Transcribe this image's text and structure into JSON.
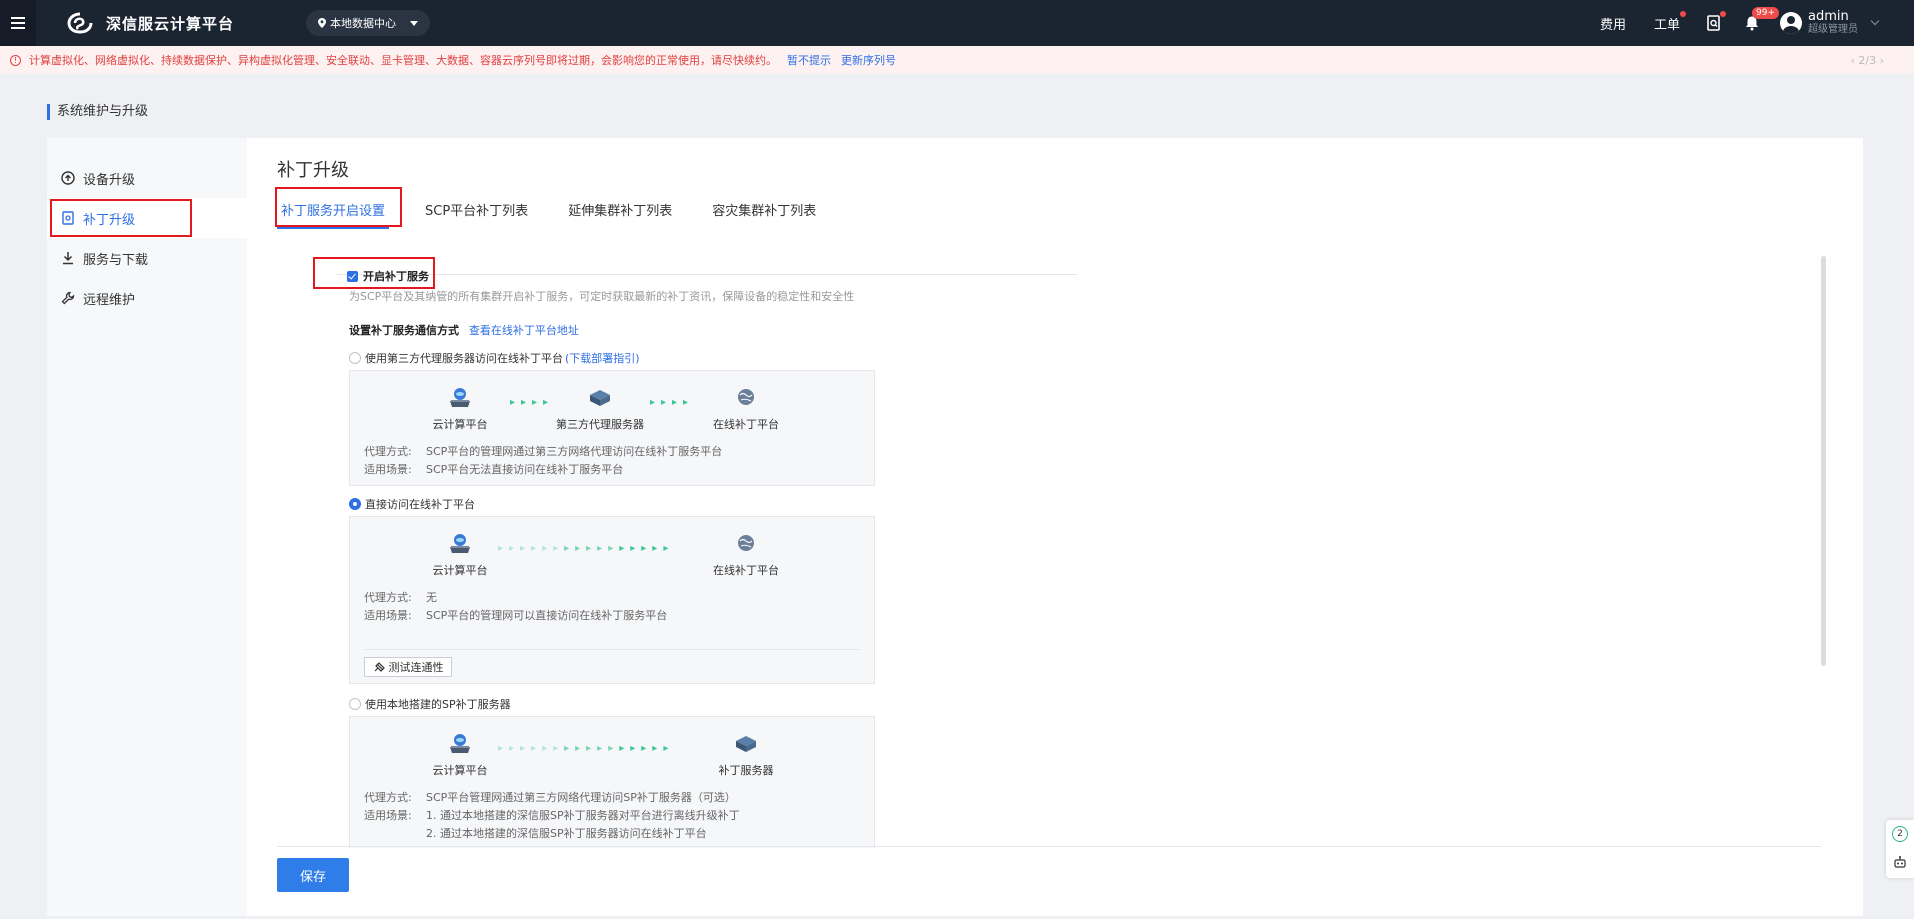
{
  "app": {
    "title": "深信服云计算平台",
    "datacenter": "本地数据中心"
  },
  "topbar": {
    "fees": "费用",
    "tickets": "工单",
    "bell_badge": "99+",
    "user_name": "admin",
    "user_role": "超级管理员"
  },
  "notice": {
    "text": "计算虚拟化、网络虚拟化、持续数据保护、异构虚拟化管理、安全联动、显卡管理、大数据、容器云序列号即将过期，会影响您的正常使用，请尽快续约。",
    "dismiss": "暂不提示",
    "update": "更新序列号",
    "pager": "‹  2/3  ›"
  },
  "breadcrumb": "系统维护与升级",
  "sidenav": {
    "items": [
      {
        "label": "设备升级",
        "icon": "upload-circle-icon"
      },
      {
        "label": "补丁升级",
        "icon": "patch-doc-icon"
      },
      {
        "label": "服务与下载",
        "icon": "download-icon"
      },
      {
        "label": "远程维护",
        "icon": "wrench-icon"
      }
    ]
  },
  "main": {
    "title": "补丁升级",
    "tabs": [
      "补丁服务开启设置",
      "SCP平台补丁列表",
      "延伸集群补丁列表",
      "容灾集群补丁列表"
    ],
    "enable_label": "开启补丁服务",
    "enable_desc": "为SCP平台及其纳管的所有集群开启补丁服务，可定时获取最新的补丁资讯，保障设备的稳定性和安全性",
    "comm_title": "设置补丁服务通信方式",
    "comm_link": "查看在线补丁平台地址",
    "options": [
      {
        "label": "使用第三方代理服务器访问在线补丁平台",
        "link": "(下载部署指引)",
        "nodes": [
          "云计算平台",
          "第三方代理服务器",
          "在线补丁平台"
        ],
        "mode_key": "代理方式:",
        "mode_val": "SCP平台的管理网通过第三方网络代理访问在线补丁服务平台",
        "scene_key": "适用场景:",
        "scene_val": "SCP平台无法直接访问在线补丁服务平台"
      },
      {
        "label": "直接访问在线补丁平台",
        "nodes": [
          "云计算平台",
          "在线补丁平台"
        ],
        "mode_key": "代理方式:",
        "mode_val": "无",
        "scene_key": "适用场景:",
        "scene_val": "SCP平台的管理网可以直接访问在线补丁服务平台",
        "test_button": "测试连通性"
      },
      {
        "label": "使用本地搭建的SP补丁服务器",
        "nodes": [
          "云计算平台",
          "补丁服务器"
        ],
        "mode_key": "代理方式:",
        "mode_val": "SCP平台管理网通过第三方网络代理访问SP补丁服务器（可选）",
        "scene_key": "适用场景:",
        "scene_val": "1. 通过本地搭建的深信服SP补丁服务器对平台进行离线升级补丁",
        "scene_val2": "2. 通过本地搭建的深信服SP补丁服务器访问在线补丁平台"
      }
    ],
    "save": "保存"
  },
  "float_tools": {
    "count": "2"
  },
  "colors": {
    "accent": "#2f6fe4",
    "topbar": "#1b2431",
    "highlight": "#e3191e",
    "arrow": "#3cc796"
  }
}
